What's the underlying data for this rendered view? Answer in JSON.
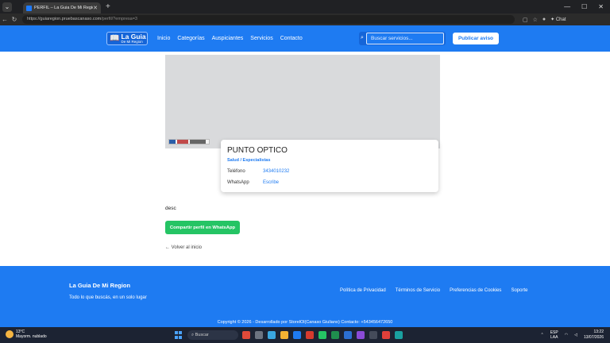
{
  "browser": {
    "tab_title": "PERFIL – La Guia De Mi Region",
    "url_domain": "https://guiaregion.pruebascanaso.com",
    "url_path": "/perfil/?empresa=3",
    "chat_label": "Chat"
  },
  "header": {
    "logo_line1": "La Guia",
    "logo_line2": "De Mi Region",
    "nav": [
      "Inicio",
      "Categorías",
      "Auspiciantes",
      "Servicios",
      "Contacto"
    ],
    "search_placeholder": "Buscar servicios...",
    "publish_label": "Publicar aviso"
  },
  "profile": {
    "name": "PUNTO OPTICO",
    "category": "Salud / Especialistas",
    "phone_label": "Teléfono",
    "phone_value": "3434010232",
    "whatsapp_label": "WhatsApp",
    "whatsapp_value": "Escribe",
    "description": "desc",
    "share_label": "Compartir perfil en WhatsApp",
    "back_label": "← Volver al inicio"
  },
  "footer": {
    "title": "La Guia De Mi Region",
    "tagline": "Todo lo que buscás, en un solo lugar",
    "links": [
      "Política de Privacidad",
      "Términos de Servicio",
      "Preferencias de Cookies",
      "Soporte"
    ],
    "copyright": "Copyright © 2026 - Desarrollado por StorelOl(Canaso Giuliano) Contacto: +543456472650"
  },
  "taskbar": {
    "temp": "13°C",
    "weather": "Mayorm. nublado",
    "search": "Buscar",
    "lang1": "ESP",
    "lang2": "LAA",
    "time": "13:22",
    "date": "13/07/2026"
  },
  "colors": {
    "brand_blue": "#1e7bf2",
    "whatsapp_green": "#25c464"
  }
}
